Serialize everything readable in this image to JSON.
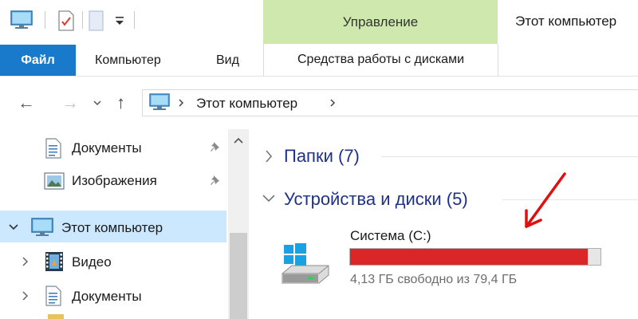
{
  "titlebar": {
    "manage_tab": "Управление",
    "window_title": "Этот компьютер"
  },
  "ribbon": {
    "file_tab": "Файл",
    "tabs": [
      "Компьютер",
      "Вид"
    ],
    "disk_tools_tab": "Средства работы с дисками"
  },
  "address": {
    "path": "Этот компьютер"
  },
  "navpane": {
    "items": [
      {
        "label": "Документы",
        "icon": "document-icon",
        "pinned": true
      },
      {
        "label": "Изображения",
        "icon": "pictures-icon",
        "pinned": true
      },
      {
        "label": "Этот компьютер",
        "icon": "computer-icon",
        "selected": true,
        "expanded": true
      },
      {
        "label": "Видео",
        "icon": "video-icon"
      },
      {
        "label": "Документы",
        "icon": "document-icon"
      }
    ]
  },
  "content": {
    "groups": [
      {
        "title": "Папки (7)",
        "expanded": false
      },
      {
        "title": "Устройства и диски (5)",
        "expanded": true
      }
    ],
    "drive": {
      "name": "Система (C:)",
      "free_text": "4,13 ГБ свободно из 79,4 ГБ",
      "used_fraction": 0.948,
      "bar_color": "#da2626"
    }
  },
  "annotation": {
    "type": "red-arrow",
    "color": "#e01010"
  },
  "colors": {
    "accent": "#1979ca",
    "manage": "#cfe8ae",
    "group_title": "#1e3287",
    "selection": "#cce8ff"
  }
}
